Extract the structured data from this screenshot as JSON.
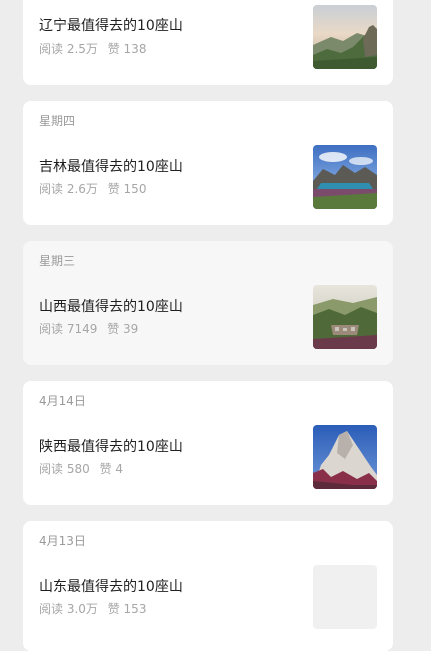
{
  "articles": [
    {
      "date": "",
      "title": "辽宁最值得去的10座山",
      "reads": "阅读 2.5万",
      "likes": "赞 138",
      "image": "liaoning-mountain-photo"
    },
    {
      "date": "星期四",
      "title": "吉林最值得去的10座山",
      "reads": "阅读 2.6万",
      "likes": "赞 150",
      "image": "jilin-lake-photo"
    },
    {
      "date": "星期三",
      "title": "山西最值得去的10座山",
      "reads": "阅读 7149",
      "likes": "赞 39",
      "image": "shanxi-valley-photo"
    },
    {
      "date": "4月14日",
      "title": "陕西最值得去的10座山",
      "reads": "阅读 580",
      "likes": "赞 4",
      "image": "shaanxi-peak-photo"
    },
    {
      "date": "4月13日",
      "title": "山东最值得去的10座山",
      "reads": "阅读 3.0万",
      "likes": "赞 153",
      "image": "image-placeholder"
    }
  ],
  "colors": {
    "page_background": "#ededed",
    "card_background": "#ffffff",
    "title_text": "#1f1f1f",
    "meta_text": "#a6a6a6"
  }
}
